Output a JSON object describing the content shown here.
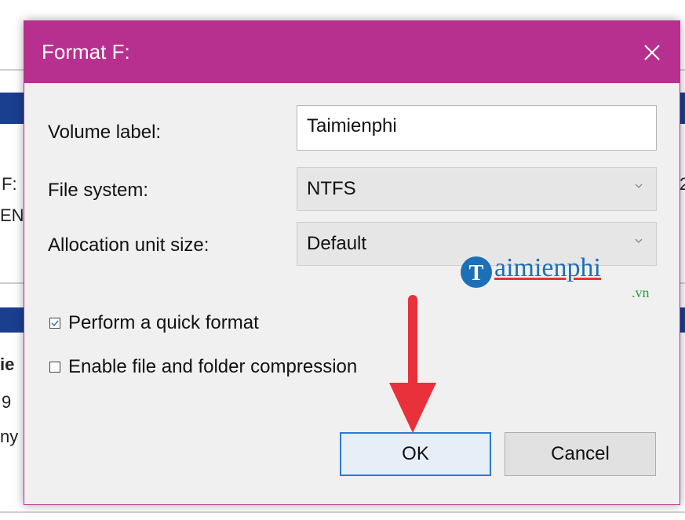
{
  "dialog": {
    "title": "Format F:",
    "fields": {
      "volume_label": {
        "label": "Volume label:",
        "value": "Taimienphi"
      },
      "file_system": {
        "label": "File system:",
        "value": "NTFS"
      },
      "allocation": {
        "label": "Allocation unit size:",
        "value": "Default"
      }
    },
    "options": {
      "quick_format": {
        "label": "Perform a quick format",
        "checked": true
      },
      "compression": {
        "label": "Enable file and folder compression",
        "checked": false
      }
    },
    "buttons": {
      "ok": "OK",
      "cancel": "Cancel"
    }
  },
  "background": {
    "left_fragments": [
      "F:",
      "EN",
      "ie",
      "9",
      "ny"
    ],
    "right_fragments": [
      "2"
    ]
  },
  "watermark": {
    "brand": "aimienphi",
    "suffix": ".vn"
  },
  "colors": {
    "titlebar": "#b8308f",
    "annotation_arrow": "#e8313a",
    "default_button_border": "#2b7ad1"
  }
}
